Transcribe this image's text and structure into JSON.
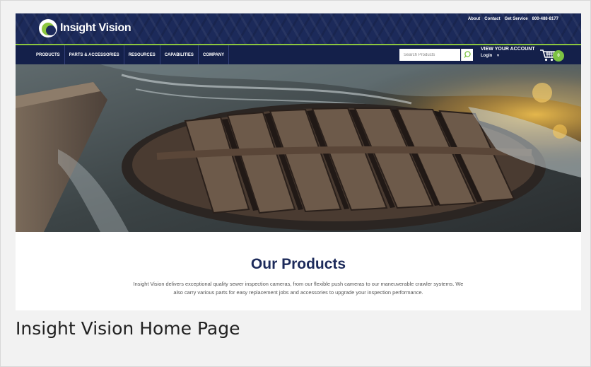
{
  "brand": {
    "name": "Insight Vision"
  },
  "top_links": [
    "About",
    "Contact",
    "Get Service",
    "800-488-8177"
  ],
  "nav": [
    "PRODUCTS",
    "PARTS & ACCESSORIES",
    "RESOURCES",
    "CAPABILITIES",
    "COMPANY"
  ],
  "search": {
    "placeholder": "Search Products"
  },
  "account": {
    "title": "VIEW YOUR ACCOUNT",
    "login": "Login"
  },
  "cart": {
    "count": "0"
  },
  "products": {
    "heading": "Our Products",
    "description": "Insight Vision delivers exceptional quality sewer inspection cameras, from our flexible push cameras to our maneuverable crawler systems. We also carry various parts for easy replacement jobs and accessories to upgrade your inspection performance."
  },
  "caption": "Insight Vision Home Page",
  "colors": {
    "navy": "#1c2a5a",
    "green": "#8cc63f"
  },
  "icons": [
    "logo-mark-icon",
    "search-icon",
    "chevron-down-icon",
    "cart-icon"
  ]
}
